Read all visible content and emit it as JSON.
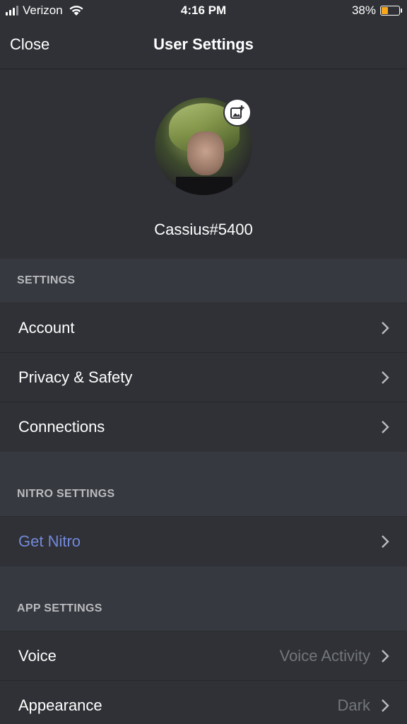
{
  "status_bar": {
    "carrier": "Verizon",
    "time": "4:16 PM",
    "battery_percent": "38%",
    "battery_level": 0.38,
    "battery_color": "#faa61a"
  },
  "header": {
    "close_label": "Close",
    "title": "User Settings"
  },
  "profile": {
    "username": "Cassius#5400",
    "edit_icon": "add-image-icon"
  },
  "sections": {
    "settings": {
      "label": "SETTINGS",
      "items": [
        {
          "label": "Account"
        },
        {
          "label": "Privacy & Safety"
        },
        {
          "label": "Connections"
        }
      ]
    },
    "nitro": {
      "label": "NITRO SETTINGS",
      "items": [
        {
          "label": "Get Nitro"
        }
      ]
    },
    "app": {
      "label": "APP SETTINGS",
      "items": [
        {
          "label": "Voice",
          "value": "Voice Activity"
        },
        {
          "label": "Appearance",
          "value": "Dark"
        }
      ]
    }
  },
  "colors": {
    "nitro_accent": "#7289da",
    "background": "#36393f",
    "panel": "#2f3136"
  }
}
